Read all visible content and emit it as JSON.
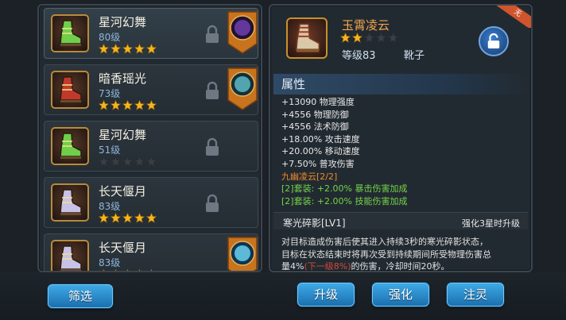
{
  "items": [
    {
      "name": "星河幻舞",
      "level": "80级",
      "stars": 5,
      "locked": true,
      "gem": "purple"
    },
    {
      "name": "暗香瑶光",
      "level": "73级",
      "stars": 5,
      "locked": true,
      "gem": "teal"
    },
    {
      "name": "星河幻舞",
      "level": "51级",
      "stars": 0,
      "locked": true,
      "gem": ""
    },
    {
      "name": "长天偃月",
      "level": "83级",
      "stars": 5,
      "locked": true,
      "gem": ""
    },
    {
      "name": "长天偃月",
      "level": "83级",
      "stars": 5,
      "locked": false,
      "gem": "blue"
    }
  ],
  "detail": {
    "name": "玉霄凌云",
    "stars_filled": 2,
    "stars_total": 5,
    "level": "等级83",
    "type": "靴子",
    "ribbon": "无",
    "attributes_title": "属性",
    "attributes": [
      "+13090 物理强度",
      "+4556 物理防御",
      "+4556 法术防御",
      "+18.00% 攻击速度",
      "+20.00% 移动速度",
      "+7.50% 普攻伤害"
    ],
    "set_name": "九幽凌云[2/2]",
    "set_bonuses": [
      "[2]套装: +2.00% 暴击伤害加成",
      "[2]套装: +2.00% 技能伤害加成"
    ],
    "skill_name": "寒光碎影[LV1]",
    "skill_upgrade": "强化3星时升级",
    "skill_desc_1": "对目标造成伤害后使其进入持续3秒的寒光碎影状态，",
    "skill_desc_2": "目标在状态结束时将再次受到持续期间所受物理伤害总",
    "skill_desc_3a": "量4%",
    "skill_desc_3b": "(下一级8%)",
    "skill_desc_3c": "的伤害，冷却时间20秒。"
  },
  "buttons": {
    "filter": "筛选",
    "upgrade": "升级",
    "enhance": "强化",
    "infuse": "注灵"
  },
  "colors": {
    "accent_blue": "#2b8fd0",
    "item_name": "#f3a64b",
    "set_name": "#f08a2a",
    "set_bonus": "#74d34a",
    "star": "#f5b51c"
  }
}
